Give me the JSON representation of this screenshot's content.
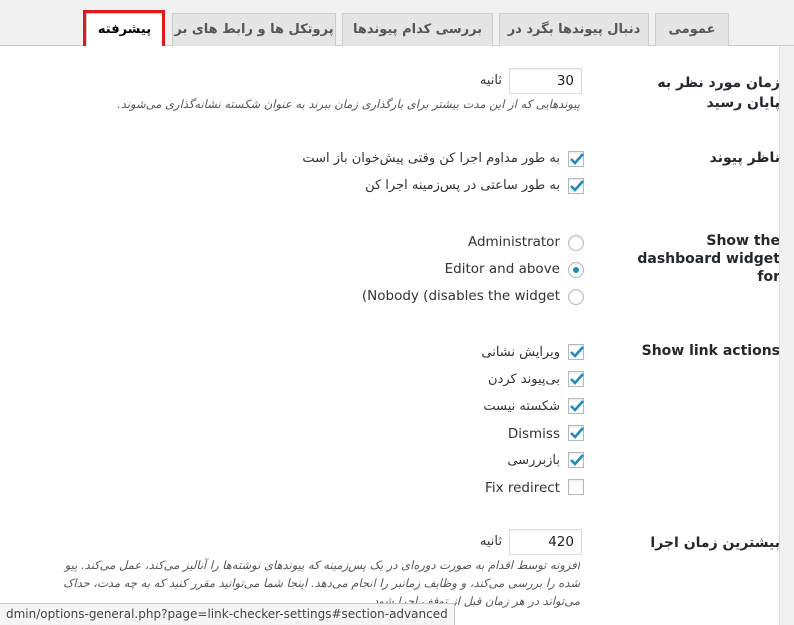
{
  "tabs": [
    {
      "label": "عمومی"
    },
    {
      "label": "دنبال پیوندها بگرد در"
    },
    {
      "label": "بررسی کدام پیوندها"
    },
    {
      "label": "پروتکل ها و رابط های بر"
    },
    {
      "label": "پیشرفته"
    }
  ],
  "highlight_color": "#e0191e",
  "timeout": {
    "label": "زمان مورد نظر به پایان رسید",
    "value": "30",
    "unit": "ثانیه",
    "description": "پیوندهایی که از این مدت بیشتر برای بارگذاری زمان ببرند به عنوان شکسته نشانه‌گذاری می‌شوند."
  },
  "link_monitor": {
    "label": "ناظر پیوند",
    "options": [
      {
        "label": "به طور مداوم اجرا کن وقتی پیش‌خوان باز است",
        "checked": true
      },
      {
        "label": "به طور ساعتی در پس‌زمینه اجرا کن",
        "checked": true
      }
    ]
  },
  "dashboard_widget": {
    "label": "Show the dashboard widget for",
    "options": [
      {
        "label": "Administrator",
        "selected": false
      },
      {
        "label": "Editor and above",
        "selected": true
      },
      {
        "label": "(Nobody (disables the widget",
        "selected": false
      }
    ]
  },
  "link_actions": {
    "label": "Show link actions",
    "options": [
      {
        "label": "ویرایش نشانی",
        "checked": true
      },
      {
        "label": "بی‌پیوند کردن",
        "checked": true
      },
      {
        "label": "شکسته نیست",
        "checked": true
      },
      {
        "label": "Dismiss",
        "checked": true
      },
      {
        "label": "بازبررسی",
        "checked": true
      },
      {
        "label": "Fix redirect",
        "checked": false
      }
    ]
  },
  "max_execution": {
    "label": "بیشترین زمان اجرا",
    "value": "420",
    "unit": "ثانیه",
    "description_lines": [
      "افزونه توسط اقدام به صورت دوره‌ای در یک پس‌زمینه که پیوندهای نوشته‌ها را آنالیز می‌کند، عمل می‌کند. پیو",
      "شده را بررسی می‌کند، و وظایف زمانبر را انجام می‌دهد. اینجا شما می‌توانید مقرر کنید که به چه مدت، حداک",
      "می‌تواند در هر زمان قبل از توقف اجرا شود."
    ]
  },
  "status_url": "dmin/options-general.php?page=link-checker-settings#section-advanced"
}
